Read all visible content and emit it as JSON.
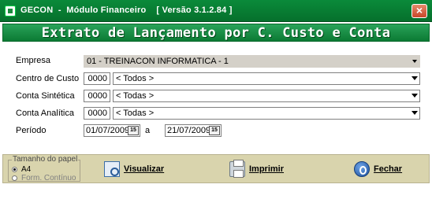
{
  "window": {
    "title": "GECON  -  Módulo Financeiro    [ Versão 3.1.2.84 ]",
    "close_glyph": "×"
  },
  "banner": {
    "title": "Extrato de Lançamento por C. Custo e Conta"
  },
  "form": {
    "empresa": {
      "label": "Empresa",
      "value": "01 - TREINACON INFORMATICA - 1"
    },
    "centro_custo": {
      "label": "Centro de Custo",
      "code": "0000",
      "value": "< Todos >"
    },
    "conta_sintetica": {
      "label": "Conta Sintética",
      "code": "0000",
      "value": "< Todas >"
    },
    "conta_analitica": {
      "label": "Conta Analítica",
      "code": "0000",
      "value": "< Todas >"
    },
    "periodo": {
      "label": "Período",
      "from": "01/07/2009",
      "separator": "a",
      "to": "21/07/2009",
      "cal_glyph": "15"
    }
  },
  "paper": {
    "title": "Tamanho do papel",
    "options": [
      {
        "label": "A4",
        "selected": true
      },
      {
        "label": "Form. Contínuo",
        "selected": false
      }
    ]
  },
  "actions": {
    "visualizar": "Visualizar",
    "imprimir": "Imprimir",
    "fechar": "Fechar"
  },
  "icons": {
    "visualizar": "magnifier-document-icon",
    "imprimir": "printer-icon",
    "fechar": "power-icon",
    "app": "app-icon",
    "calendar": "calendar-icon"
  },
  "colors": {
    "titlebar": "#0a8a3a",
    "banner": "#1a8f48",
    "toolbar": "#d9d4ad"
  }
}
